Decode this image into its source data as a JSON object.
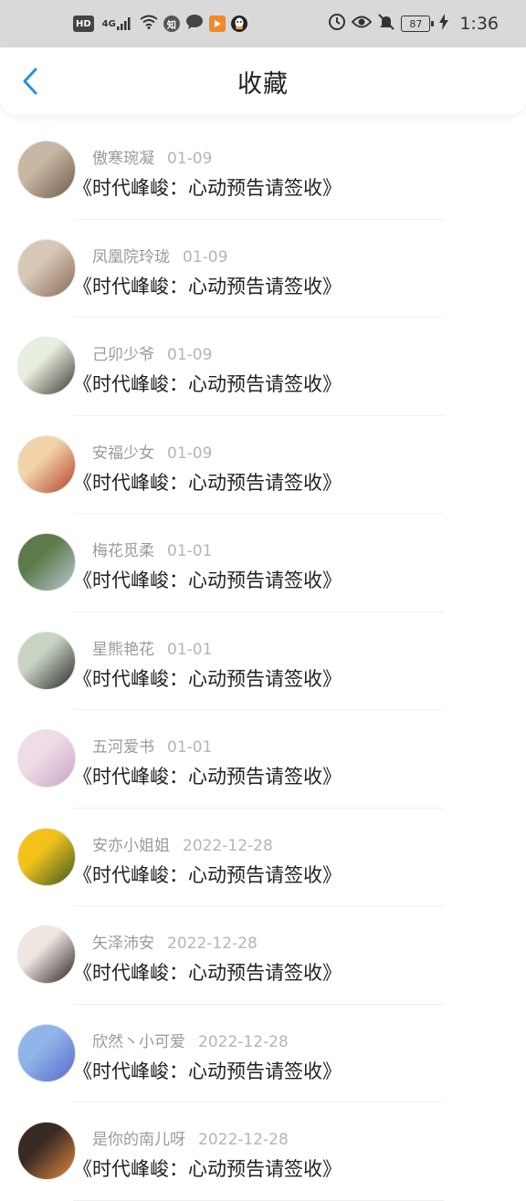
{
  "status_bar": {
    "left_chips": [
      "HD",
      "4G",
      "知"
    ],
    "battery": "87",
    "time": "1:36",
    "icons": [
      "hd-icon",
      "signal-4g-icon",
      "wifi-icon",
      "zhihu-icon",
      "message-icon",
      "video-app-icon",
      "qq-icon",
      "alarm-icon",
      "eye-icon",
      "mute-icon",
      "battery-icon",
      "charging-icon"
    ]
  },
  "header": {
    "title": "收藏",
    "back_icon": "chevron-left-icon",
    "accent": "#2a8fd6"
  },
  "items": [
    {
      "user": "傲寒琬凝",
      "date": "01-09",
      "title": "《时代峰峻：心动预告请签收》",
      "avatar_colors": [
        "#c8b7a3",
        "#6f5a4a"
      ]
    },
    {
      "user": "凤凰院玲珑",
      "date": "01-09",
      "title": "《时代峰峻：心动预告请签收》",
      "avatar_colors": [
        "#d8c8b8",
        "#8a6b55"
      ]
    },
    {
      "user": "己卯少爷",
      "date": "01-09",
      "title": "《时代峰峻：心动预告请签收》",
      "avatar_colors": [
        "#e9efe0",
        "#3b3a35"
      ]
    },
    {
      "user": "安福少女",
      "date": "01-09",
      "title": "《时代峰峻：心动预告请签收》",
      "avatar_colors": [
        "#f1d4a8",
        "#b7412c"
      ]
    },
    {
      "user": "梅花觅柔",
      "date": "01-01",
      "title": "《时代峰峻：心动预告请签收》",
      "avatar_colors": [
        "#5d7b4a",
        "#b8c7d6"
      ]
    },
    {
      "user": "星熊艳花",
      "date": "01-01",
      "title": "《时代峰峻：心动预告请签收》",
      "avatar_colors": [
        "#c8d3c4",
        "#2a2a2a"
      ]
    },
    {
      "user": "五河爱书",
      "date": "01-01",
      "title": "《时代峰峻：心动预告请签收》",
      "avatar_colors": [
        "#f0dce8",
        "#c8a6c4"
      ]
    },
    {
      "user": "安亦小姐姐",
      "date": "2022-12-28",
      "title": "《时代峰峻：心动预告请签收》",
      "avatar_colors": [
        "#f2c21b",
        "#3d5a1f"
      ]
    },
    {
      "user": "矢泽沛安",
      "date": "2022-12-28",
      "title": "《时代峰峻：心动预告请签收》",
      "avatar_colors": [
        "#efe6e2",
        "#2b2220"
      ]
    },
    {
      "user": "欣然丶小可爱",
      "date": "2022-12-28",
      "title": "《时代峰峻：心动预告请签收》",
      "avatar_colors": [
        "#8fb4e8",
        "#5c6ad0"
      ]
    },
    {
      "user": "是你的南儿呀",
      "date": "2022-12-28",
      "title": "《时代峰峻：心动预告请签收》",
      "avatar_colors": [
        "#3a2a24",
        "#e08a3a"
      ]
    }
  ]
}
